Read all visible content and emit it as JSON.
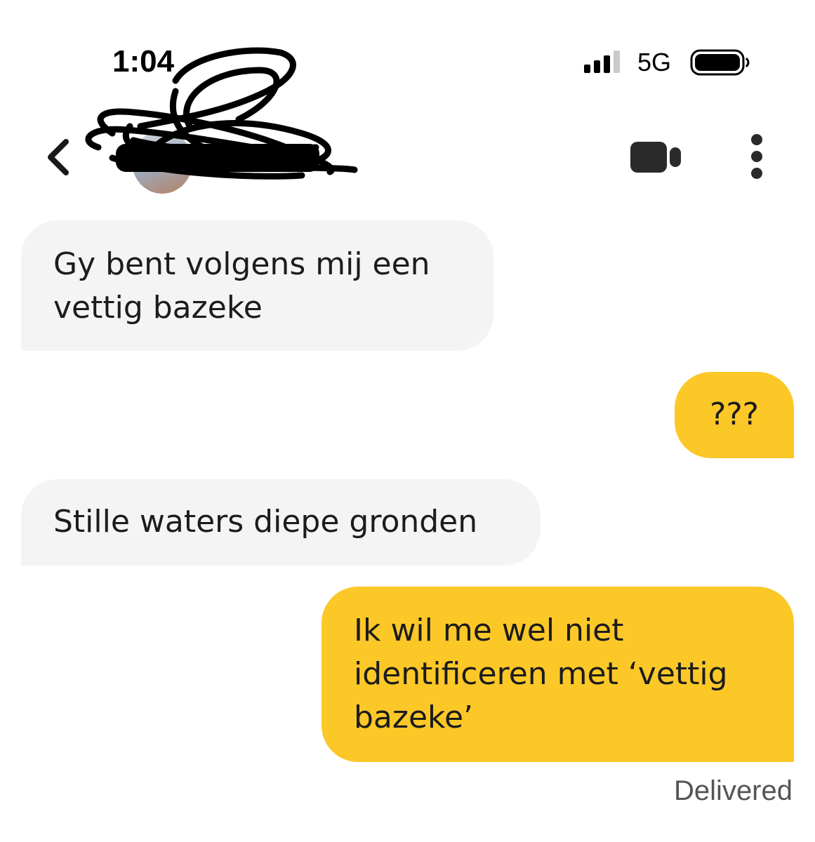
{
  "status_bar": {
    "time": "1:04",
    "network": "5G",
    "icons": [
      "signal-bars-icon",
      "battery-icon"
    ]
  },
  "header": {
    "icons": [
      "chevron-left-icon",
      "video-camera-icon",
      "more-vertical-icon"
    ],
    "contact_name_redacted": true
  },
  "colors": {
    "incoming_bubble": "#f4f4f4",
    "outgoing_bubble": "#fcc828",
    "text": "#1c1c1c",
    "status_text": "#555555"
  },
  "messages": [
    {
      "direction": "incoming",
      "text": "Gy bent volgens mij een vettig bazeke"
    },
    {
      "direction": "outgoing",
      "text": "???"
    },
    {
      "direction": "incoming",
      "text": "Stille waters diepe gronden"
    },
    {
      "direction": "outgoing",
      "text": "Ik wil me wel niet identificeren met ‘vettig bazeke’"
    }
  ],
  "delivery_status": "Delivered"
}
